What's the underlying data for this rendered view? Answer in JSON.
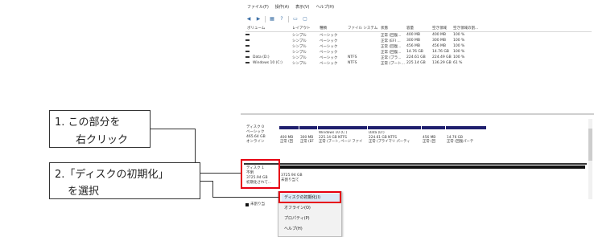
{
  "menu": [
    "ファイル(F)",
    "操作(A)",
    "表示(V)",
    "ヘルプ(H)"
  ],
  "toolbar_icons": [
    "back-arrow-icon",
    "forward-arrow-icon",
    "list-view-icon",
    "help-icon",
    "disk-icon",
    "refresh-icon"
  ],
  "volume_table": {
    "headers": [
      "ボリューム",
      "レイアウト",
      "種類",
      "ファイル システム",
      "状態",
      "容量",
      "空き領域",
      "空き領域の割..."
    ],
    "rows": [
      [
        "",
        "シンプル",
        "ベーシック",
        "",
        "正常 (回復...",
        "400 MB",
        "400 MB",
        "100 %"
      ],
      [
        "",
        "シンプル",
        "ベーシック",
        "",
        "正常 (EFI ...",
        "300 MB",
        "300 MB",
        "100 %"
      ],
      [
        "",
        "シンプル",
        "ベーシック",
        "",
        "正常 (回復...",
        "456 MB",
        "456 MB",
        "100 %"
      ],
      [
        "",
        "シンプル",
        "ベーシック",
        "",
        "正常 (回復...",
        "14.76 GB",
        "14.76 GB",
        "100 %"
      ],
      [
        "Data (D:)",
        "シンプル",
        "ベーシック",
        "NTFS",
        "正常 (プラ...",
        "224.61 GB",
        "224.49 GB",
        "100 %"
      ],
      [
        "Windows 10 (C:)",
        "シンプル",
        "ベーシック",
        "NTFS",
        "正常 (ブート...",
        "225.14 GB",
        "136.29 GB",
        "61 %"
      ]
    ]
  },
  "disk0": {
    "name": "ディスク 0",
    "type": "ベーシック",
    "size": "465.64 GB",
    "status": "オンライン",
    "partitions": [
      {
        "line1": "",
        "line2": "400 MB",
        "line3": "正常 (回"
      },
      {
        "line1": "",
        "line2": "300 MB",
        "line3": "正常 (EF"
      },
      {
        "line1": "Windows 10 (C:)",
        "line2": "225.14 GB NTFS",
        "line3": "正常 (ブート, ページ ファイ"
      },
      {
        "line1": "Data (D:)",
        "line2": "224.61 GB NTFS",
        "line3": "正常 (プライマリ パーティ"
      },
      {
        "line1": "",
        "line2": "456 MB",
        "line3": "正常 (回"
      },
      {
        "line1": "",
        "line2": "14.76 GB",
        "line3": "正常 (回復パーテ"
      }
    ]
  },
  "disk1": {
    "name": "ディスク 1",
    "type": "不明",
    "size": "3725.94 GB",
    "status": "初期化されて...",
    "unalloc_size": "3725.94 GB",
    "unalloc_label": "未割り当て"
  },
  "legend_label": "未割り当",
  "context_menu": [
    "ディスクの初期化(I)",
    "オフライン(O)",
    "プロパティ(P)",
    "ヘルプ(H)"
  ],
  "callout1": {
    "line1": "1. この部分を",
    "line2": "右クリック"
  },
  "callout2": {
    "line1": "2.「ディスクの初期化」",
    "line2": "を選択"
  },
  "highlight_color": "#e60012"
}
